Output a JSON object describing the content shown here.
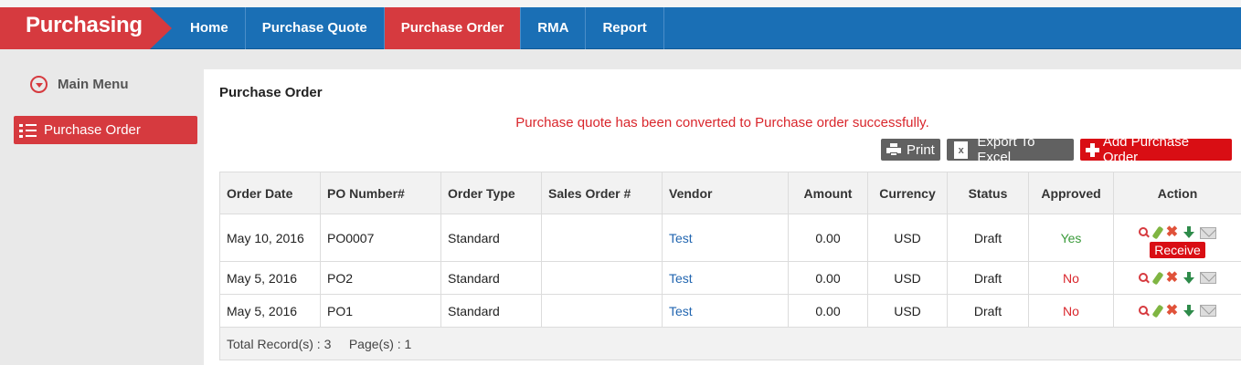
{
  "app": {
    "title": "Purchasing"
  },
  "nav": {
    "items": [
      {
        "label": "Home"
      },
      {
        "label": "Purchase Quote"
      },
      {
        "label": "Purchase Order",
        "active": true
      },
      {
        "label": "RMA"
      },
      {
        "label": "Report"
      }
    ]
  },
  "sidebar": {
    "menu_label": "Main Menu",
    "items": [
      {
        "label": "Purchase Order",
        "active": true
      }
    ]
  },
  "main": {
    "title": "Purchase Order",
    "message": "Purchase quote has been converted to Purchase order successfully.",
    "buttons": {
      "print": "Print",
      "export": "Export To Excel",
      "add": "Add Purchase Order"
    },
    "table": {
      "headers": [
        "Order Date",
        "PO Number#",
        "Order Type",
        "Sales Order #",
        "Vendor",
        "Amount",
        "Currency",
        "Status",
        "Approved",
        "Action"
      ],
      "rows": [
        {
          "order_date": "May 10, 2016",
          "po_number": "PO0007",
          "order_type": "Standard",
          "sales_order": "",
          "vendor": "Test",
          "amount": "0.00",
          "currency": "USD",
          "status": "Draft",
          "approved": "Yes",
          "tooltip": "Receive"
        },
        {
          "order_date": "May 5, 2016",
          "po_number": "PO2",
          "order_type": "Standard",
          "sales_order": "",
          "vendor": "Test",
          "amount": "0.00",
          "currency": "USD",
          "status": "Draft",
          "approved": "No"
        },
        {
          "order_date": "May 5, 2016",
          "po_number": "PO1",
          "order_type": "Standard",
          "sales_order": "",
          "vendor": "Test",
          "amount": "0.00",
          "currency": "USD",
          "status": "Draft",
          "approved": "No"
        }
      ],
      "footer": {
        "records_label": "Total Record(s) :",
        "records": "3",
        "pages_label": "Page(s) :",
        "pages": "1"
      }
    }
  },
  "colors": {
    "brand": "#d63a3f",
    "nav": "#1a6fb5",
    "link": "#2266b0"
  },
  "icons": [
    "caret-circle-icon",
    "list-icon",
    "printer-icon",
    "excel-icon",
    "plus-icon",
    "search-icon",
    "edit-icon",
    "delete-icon",
    "download-icon",
    "mail-icon"
  ]
}
